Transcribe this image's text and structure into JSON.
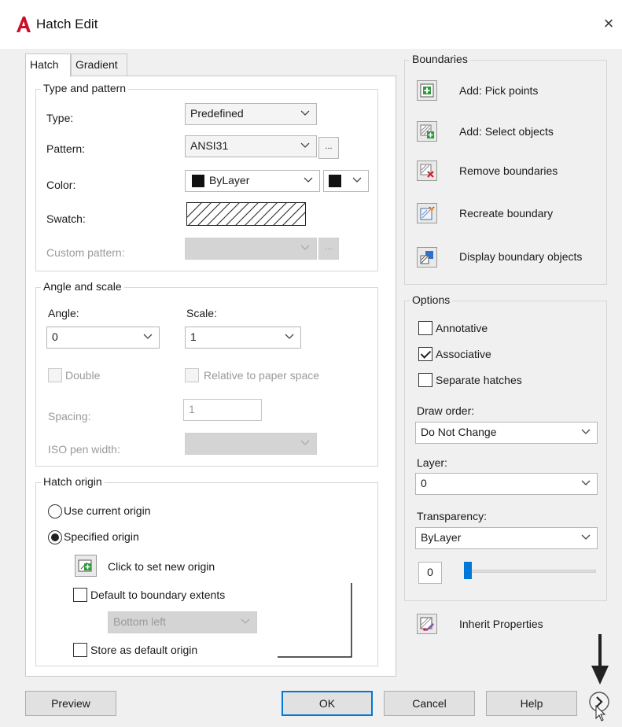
{
  "window": {
    "title": "Hatch Edit",
    "close_glyph": "×",
    "accent_color": "#0078d7",
    "icon": "autocad-a-icon"
  },
  "tabs": [
    {
      "label": "Hatch",
      "active": true
    },
    {
      "label": "Gradient",
      "active": false
    }
  ],
  "type_and_pattern": {
    "heading": "Type and pattern",
    "type_label": "Type:",
    "type_value": "Predefined",
    "pattern_label": "Pattern:",
    "pattern_value": "ANSI31",
    "pattern_browse": "...",
    "color_label": "Color:",
    "color_value": "ByLayer",
    "swatch_label": "Swatch:",
    "custom_pattern_label": "Custom pattern:",
    "custom_browse": "..."
  },
  "angle_and_scale": {
    "heading": "Angle and scale",
    "angle_label": "Angle:",
    "angle_value": "0",
    "scale_label": "Scale:",
    "scale_value": "1",
    "double_label": "Double",
    "relative_label": "Relative to paper space",
    "spacing_label": "Spacing:",
    "spacing_value": "1",
    "iso_label": "ISO pen width:"
  },
  "hatch_origin": {
    "heading": "Hatch origin",
    "use_current_label": "Use current origin",
    "specified_label": "Specified origin",
    "click_set_label": "Click to set new origin",
    "default_extents_label": "Default to boundary extents",
    "position_value": "Bottom left",
    "store_default_label": "Store as default origin"
  },
  "boundaries": {
    "heading": "Boundaries",
    "items": [
      {
        "label": "Add: Pick points",
        "icon": "add-pick-points-icon"
      },
      {
        "label": "Add: Select objects",
        "icon": "add-select-objects-icon"
      },
      {
        "label": "Remove boundaries",
        "icon": "remove-boundaries-icon"
      },
      {
        "label": "Recreate boundary",
        "icon": "recreate-boundary-icon"
      },
      {
        "label": "Display boundary objects",
        "icon": "display-boundary-objects-icon"
      }
    ]
  },
  "options": {
    "heading": "Options",
    "annotative_label": "Annotative",
    "annotative_checked": false,
    "associative_label": "Associative",
    "associative_checked": true,
    "separate_label": "Separate hatches",
    "separate_checked": false,
    "draw_order_label": "Draw order:",
    "draw_order_value": "Do Not Change",
    "layer_label": "Layer:",
    "layer_value": "0",
    "transparency_label": "Transparency:",
    "transparency_value": "ByLayer",
    "transparency_amount": "0"
  },
  "inherit": {
    "label": "Inherit Properties",
    "icon": "inherit-properties-icon"
  },
  "footer": {
    "preview": "Preview",
    "ok": "OK",
    "cancel": "Cancel",
    "help": "Help",
    "more_icon": "chevron-right-circle-icon"
  }
}
